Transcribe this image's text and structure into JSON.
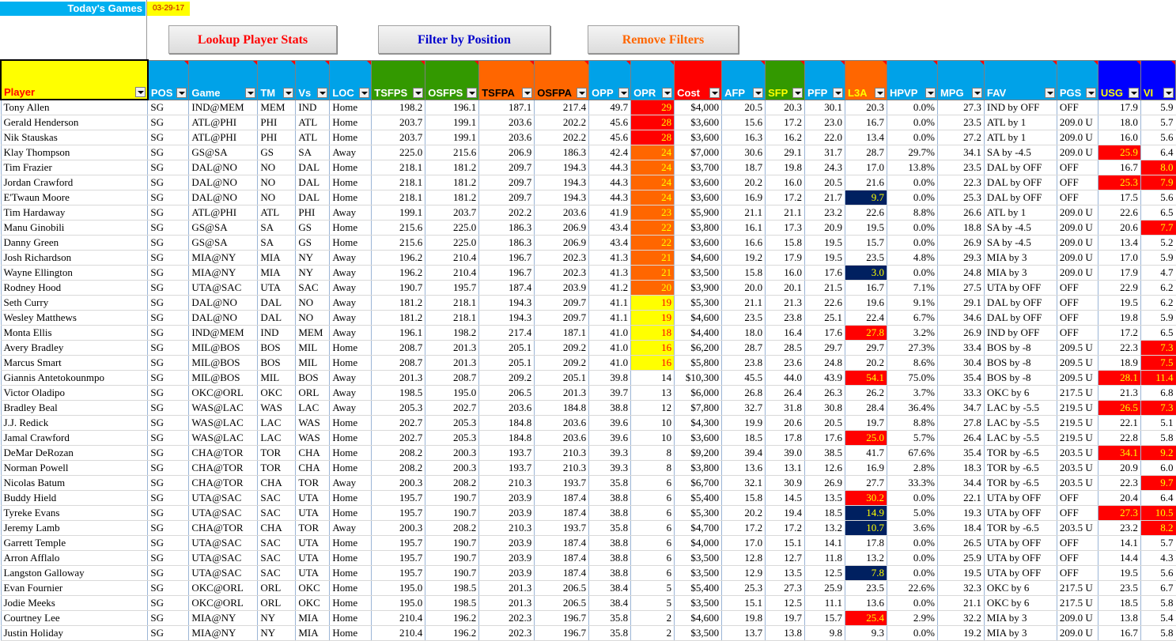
{
  "header": {
    "title": "Today's Games",
    "date": "03-29-17",
    "buttons": {
      "lookup": "Lookup Player Stats",
      "filter": "Filter by Position",
      "remove": "Remove Filters"
    }
  },
  "colors": {
    "yellow": "#ffff00",
    "orange": "#ff6600",
    "red": "#ff0000",
    "navy": "#002060",
    "green": "#339900",
    "blue": "#00a2e8",
    "darkblue": "#0000ff",
    "accent_text_red": "#ff0000",
    "accent_text_blue": "#0000cc"
  },
  "columns": [
    {
      "key": "player",
      "label": "Player",
      "width": 186,
      "bg": "#ffff00",
      "fg": "#ff0000"
    },
    {
      "key": "pos",
      "label": "POS",
      "width": 52,
      "bg": "#00a2e8",
      "fg": "#ffffff"
    },
    {
      "key": "game",
      "label": "Game",
      "width": 87,
      "bg": "#00a2e8",
      "fg": "#ffffff"
    },
    {
      "key": "tm",
      "label": "TM",
      "width": 48,
      "bg": "#00a2e8",
      "fg": "#ffffff"
    },
    {
      "key": "vs",
      "label": "Vs",
      "width": 43,
      "bg": "#00a2e8",
      "fg": "#ffffff"
    },
    {
      "key": "loc",
      "label": "LOC",
      "width": 53,
      "bg": "#00a2e8",
      "fg": "#ffffff"
    },
    {
      "key": "tsfps",
      "label": "TSFPS",
      "width": 68,
      "bg": "#339900",
      "fg": "#ffffff"
    },
    {
      "key": "osfps",
      "label": "OSFPS",
      "width": 68,
      "bg": "#339900",
      "fg": "#ffffff"
    },
    {
      "key": "tsfpa",
      "label": "TSFPA",
      "width": 70,
      "bg": "#ff6600",
      "fg": "#000000"
    },
    {
      "key": "osfpa",
      "label": "OSFPA",
      "width": 69,
      "bg": "#ff6600",
      "fg": "#000000"
    },
    {
      "key": "opp",
      "label": "OPP",
      "width": 53,
      "bg": "#00a2e8",
      "fg": "#ffffff"
    },
    {
      "key": "opr",
      "label": "OPR",
      "width": 55,
      "bg": "#00a2e8",
      "fg": "#ffffff"
    },
    {
      "key": "cost",
      "label": "Cost",
      "width": 60,
      "bg": "#ff0000",
      "fg": "#ffffff"
    },
    {
      "key": "afp",
      "label": "AFP",
      "width": 55,
      "bg": "#00a2e8",
      "fg": "#ffffff"
    },
    {
      "key": "sfp",
      "label": "SFP",
      "width": 50,
      "bg": "#339900",
      "fg": "#ffff00"
    },
    {
      "key": "pfp",
      "label": "PFP",
      "width": 51,
      "bg": "#00a2e8",
      "fg": "#ffffff"
    },
    {
      "key": "l3a",
      "label": "L3A",
      "width": 53,
      "bg": "#ff6600",
      "fg": "#ffff00"
    },
    {
      "key": "hpvp",
      "label": "HPVP",
      "width": 64,
      "bg": "#00a2e8",
      "fg": "#ffffff"
    },
    {
      "key": "mpg",
      "label": "MPG",
      "width": 59,
      "bg": "#00a2e8",
      "fg": "#ffffff"
    },
    {
      "key": "fav",
      "label": "FAV",
      "width": 92,
      "bg": "#00a2e8",
      "fg": "#ffffff"
    },
    {
      "key": "pgs",
      "label": "PGS",
      "width": 52,
      "bg": "#00a2e8",
      "fg": "#ffffff"
    },
    {
      "key": "usg",
      "label": "USG",
      "width": 54,
      "bg": "#0000ff",
      "fg": "#ffff00"
    },
    {
      "key": "vi",
      "label": "VI",
      "width": 44,
      "bg": "#0000ff",
      "fg": "#ffff00"
    }
  ],
  "rows": [
    [
      "Tony Allen",
      "SG",
      "IND@MEM",
      "MEM",
      "IND",
      "Home",
      "198.2",
      "196.1",
      "187.1",
      "217.4",
      "49.7",
      "29",
      "$4,000",
      "20.5",
      "20.3",
      "30.1",
      "20.3",
      "0.0%",
      "27.3",
      "IND by OFF",
      "OFF",
      "17.9",
      "5.9"
    ],
    [
      "Gerald Henderson",
      "SG",
      "ATL@PHI",
      "PHI",
      "ATL",
      "Home",
      "203.7",
      "199.1",
      "203.6",
      "202.2",
      "45.6",
      "28",
      "$3,600",
      "15.6",
      "17.2",
      "23.0",
      "16.7",
      "0.0%",
      "23.5",
      "ATL by 1",
      "209.0 U",
      "18.0",
      "5.7"
    ],
    [
      "Nik Stauskas",
      "SG",
      "ATL@PHI",
      "PHI",
      "ATL",
      "Home",
      "203.7",
      "199.1",
      "203.6",
      "202.2",
      "45.6",
      "28",
      "$3,600",
      "16.3",
      "16.2",
      "22.0",
      "13.4",
      "0.0%",
      "27.2",
      "ATL by 1",
      "209.0 U",
      "16.0",
      "5.6"
    ],
    [
      "Klay Thompson",
      "SG",
      "GS@SA",
      "GS",
      "SA",
      "Away",
      "225.0",
      "215.6",
      "206.9",
      "186.3",
      "42.4",
      "24",
      "$7,000",
      "30.6",
      "29.1",
      "31.7",
      "28.7",
      "29.7%",
      "34.1",
      "SA by -4.5",
      "209.0 U",
      "25.9",
      "6.4"
    ],
    [
      "Tim Frazier",
      "SG",
      "DAL@NO",
      "NO",
      "DAL",
      "Home",
      "218.1",
      "181.2",
      "209.7",
      "194.3",
      "44.3",
      "24",
      "$3,700",
      "18.7",
      "19.8",
      "24.3",
      "17.0",
      "13.8%",
      "23.5",
      "DAL by OFF",
      "OFF",
      "16.7",
      "8.0"
    ],
    [
      "Jordan Crawford",
      "SG",
      "DAL@NO",
      "NO",
      "DAL",
      "Home",
      "218.1",
      "181.2",
      "209.7",
      "194.3",
      "44.3",
      "24",
      "$3,600",
      "20.2",
      "16.0",
      "20.5",
      "21.6",
      "0.0%",
      "22.3",
      "DAL by OFF",
      "OFF",
      "25.3",
      "7.9"
    ],
    [
      "E'Twaun Moore",
      "SG",
      "DAL@NO",
      "NO",
      "DAL",
      "Home",
      "218.1",
      "181.2",
      "209.7",
      "194.3",
      "44.3",
      "24",
      "$3,600",
      "16.9",
      "17.2",
      "21.7",
      "9.7",
      "0.0%",
      "25.3",
      "DAL by OFF",
      "OFF",
      "17.5",
      "5.6"
    ],
    [
      "Tim Hardaway",
      "SG",
      "ATL@PHI",
      "ATL",
      "PHI",
      "Away",
      "199.1",
      "203.7",
      "202.2",
      "203.6",
      "41.9",
      "23",
      "$5,900",
      "21.1",
      "21.1",
      "23.2",
      "22.6",
      "8.8%",
      "26.6",
      "ATL by 1",
      "209.0 U",
      "22.6",
      "6.5"
    ],
    [
      "Manu Ginobili",
      "SG",
      "GS@SA",
      "SA",
      "GS",
      "Home",
      "215.6",
      "225.0",
      "186.3",
      "206.9",
      "43.4",
      "22",
      "$3,800",
      "16.1",
      "17.3",
      "20.9",
      "19.5",
      "0.0%",
      "18.8",
      "SA by -4.5",
      "209.0 U",
      "20.6",
      "7.7"
    ],
    [
      "Danny Green",
      "SG",
      "GS@SA",
      "SA",
      "GS",
      "Home",
      "215.6",
      "225.0",
      "186.3",
      "206.9",
      "43.4",
      "22",
      "$3,600",
      "16.6",
      "15.8",
      "19.5",
      "15.7",
      "0.0%",
      "26.9",
      "SA by -4.5",
      "209.0 U",
      "13.4",
      "5.2"
    ],
    [
      "Josh Richardson",
      "SG",
      "MIA@NY",
      "MIA",
      "NY",
      "Away",
      "196.2",
      "210.4",
      "196.7",
      "202.3",
      "41.3",
      "21",
      "$4,600",
      "19.2",
      "17.9",
      "19.5",
      "23.5",
      "4.8%",
      "29.3",
      "MIA by 3",
      "209.0 U",
      "17.0",
      "5.9"
    ],
    [
      "Wayne Ellington",
      "SG",
      "MIA@NY",
      "MIA",
      "NY",
      "Away",
      "196.2",
      "210.4",
      "196.7",
      "202.3",
      "41.3",
      "21",
      "$3,500",
      "15.8",
      "16.0",
      "17.6",
      "3.0",
      "0.0%",
      "24.8",
      "MIA by 3",
      "209.0 U",
      "17.9",
      "4.7"
    ],
    [
      "Rodney Hood",
      "SG",
      "UTA@SAC",
      "UTA",
      "SAC",
      "Away",
      "190.7",
      "195.7",
      "187.4",
      "203.9",
      "41.2",
      "20",
      "$3,900",
      "20.0",
      "20.1",
      "21.5",
      "16.7",
      "7.1%",
      "27.5",
      "UTA by OFF",
      "OFF",
      "22.9",
      "6.2"
    ],
    [
      "Seth Curry",
      "SG",
      "DAL@NO",
      "DAL",
      "NO",
      "Away",
      "181.2",
      "218.1",
      "194.3",
      "209.7",
      "41.1",
      "19",
      "$5,300",
      "21.1",
      "21.3",
      "22.6",
      "19.6",
      "9.1%",
      "29.1",
      "DAL by OFF",
      "OFF",
      "19.5",
      "6.2"
    ],
    [
      "Wesley Matthews",
      "SG",
      "DAL@NO",
      "DAL",
      "NO",
      "Away",
      "181.2",
      "218.1",
      "194.3",
      "209.7",
      "41.1",
      "19",
      "$4,600",
      "23.5",
      "23.8",
      "25.1",
      "22.4",
      "6.7%",
      "34.6",
      "DAL by OFF",
      "OFF",
      "19.8",
      "5.9"
    ],
    [
      "Monta Ellis",
      "SG",
      "IND@MEM",
      "IND",
      "MEM",
      "Away",
      "196.1",
      "198.2",
      "217.4",
      "187.1",
      "41.0",
      "18",
      "$4,400",
      "18.0",
      "16.4",
      "17.6",
      "27.8",
      "3.2%",
      "26.9",
      "IND by OFF",
      "OFF",
      "17.2",
      "6.5"
    ],
    [
      "Avery Bradley",
      "SG",
      "MIL@BOS",
      "BOS",
      "MIL",
      "Home",
      "208.7",
      "201.3",
      "205.1",
      "209.2",
      "41.0",
      "16",
      "$6,200",
      "28.7",
      "28.5",
      "29.7",
      "29.7",
      "27.3%",
      "33.4",
      "BOS by -8",
      "209.5 U",
      "22.3",
      "7.3"
    ],
    [
      "Marcus Smart",
      "SG",
      "MIL@BOS",
      "BOS",
      "MIL",
      "Home",
      "208.7",
      "201.3",
      "205.1",
      "209.2",
      "41.0",
      "16",
      "$5,800",
      "23.8",
      "23.6",
      "24.8",
      "20.2",
      "8.6%",
      "30.4",
      "BOS by -8",
      "209.5 U",
      "18.9",
      "7.5"
    ],
    [
      "Giannis Antetokounmpo",
      "SG",
      "MIL@BOS",
      "MIL",
      "BOS",
      "Away",
      "201.3",
      "208.7",
      "209.2",
      "205.1",
      "39.8",
      "14",
      "$10,300",
      "45.5",
      "44.0",
      "43.9",
      "54.1",
      "75.0%",
      "35.4",
      "BOS by -8",
      "209.5 U",
      "28.1",
      "11.4"
    ],
    [
      "Victor Oladipo",
      "SG",
      "OKC@ORL",
      "OKC",
      "ORL",
      "Away",
      "198.5",
      "195.0",
      "206.5",
      "201.3",
      "39.7",
      "13",
      "$6,000",
      "26.8",
      "26.4",
      "26.3",
      "26.2",
      "3.7%",
      "33.3",
      "OKC by 6",
      "217.5 U",
      "21.3",
      "6.8"
    ],
    [
      "Bradley Beal",
      "SG",
      "WAS@LAC",
      "WAS",
      "LAC",
      "Away",
      "205.3",
      "202.7",
      "203.6",
      "184.8",
      "38.8",
      "12",
      "$7,800",
      "32.7",
      "31.8",
      "30.8",
      "28.4",
      "36.4%",
      "34.7",
      "LAC by -5.5",
      "219.5 U",
      "26.5",
      "7.3"
    ],
    [
      "J.J. Redick",
      "SG",
      "WAS@LAC",
      "LAC",
      "WAS",
      "Home",
      "202.7",
      "205.3",
      "184.8",
      "203.6",
      "39.6",
      "10",
      "$4,300",
      "19.9",
      "20.6",
      "20.5",
      "19.7",
      "8.8%",
      "27.8",
      "LAC by -5.5",
      "219.5 U",
      "22.1",
      "5.1"
    ],
    [
      "Jamal Crawford",
      "SG",
      "WAS@LAC",
      "LAC",
      "WAS",
      "Home",
      "202.7",
      "205.3",
      "184.8",
      "203.6",
      "39.6",
      "10",
      "$3,600",
      "18.5",
      "17.8",
      "17.6",
      "25.0",
      "5.7%",
      "26.4",
      "LAC by -5.5",
      "219.5 U",
      "22.8",
      "5.8"
    ],
    [
      "DeMar DeRozan",
      "SG",
      "CHA@TOR",
      "TOR",
      "CHA",
      "Home",
      "208.2",
      "200.3",
      "193.7",
      "210.3",
      "39.3",
      "8",
      "$9,200",
      "39.4",
      "39.0",
      "38.5",
      "41.7",
      "67.6%",
      "35.4",
      "TOR by -6.5",
      "203.5 U",
      "34.1",
      "9.2"
    ],
    [
      "Norman Powell",
      "SG",
      "CHA@TOR",
      "TOR",
      "CHA",
      "Home",
      "208.2",
      "200.3",
      "193.7",
      "210.3",
      "39.3",
      "8",
      "$3,800",
      "13.6",
      "13.1",
      "12.6",
      "16.9",
      "2.8%",
      "18.3",
      "TOR by -6.5",
      "203.5 U",
      "20.9",
      "6.0"
    ],
    [
      "Nicolas Batum",
      "SG",
      "CHA@TOR",
      "CHA",
      "TOR",
      "Away",
      "200.3",
      "208.2",
      "210.3",
      "193.7",
      "35.8",
      "6",
      "$6,700",
      "32.1",
      "30.9",
      "26.9",
      "27.7",
      "33.3%",
      "34.4",
      "TOR by -6.5",
      "203.5 U",
      "22.3",
      "9.7"
    ],
    [
      "Buddy Hield",
      "SG",
      "UTA@SAC",
      "SAC",
      "UTA",
      "Home",
      "195.7",
      "190.7",
      "203.9",
      "187.4",
      "38.8",
      "6",
      "$5,400",
      "15.8",
      "14.5",
      "13.5",
      "30.2",
      "0.0%",
      "22.1",
      "UTA by OFF",
      "OFF",
      "20.4",
      "6.4"
    ],
    [
      "Tyreke Evans",
      "SG",
      "UTA@SAC",
      "SAC",
      "UTA",
      "Home",
      "195.7",
      "190.7",
      "203.9",
      "187.4",
      "38.8",
      "6",
      "$5,300",
      "20.2",
      "19.4",
      "18.5",
      "14.9",
      "5.0%",
      "19.3",
      "UTA by OFF",
      "OFF",
      "27.3",
      "10.5"
    ],
    [
      "Jeremy Lamb",
      "SG",
      "CHA@TOR",
      "CHA",
      "TOR",
      "Away",
      "200.3",
      "208.2",
      "210.3",
      "193.7",
      "35.8",
      "6",
      "$4,700",
      "17.2",
      "17.2",
      "13.2",
      "10.7",
      "3.6%",
      "18.4",
      "TOR by -6.5",
      "203.5 U",
      "23.2",
      "8.2"
    ],
    [
      "Garrett Temple",
      "SG",
      "UTA@SAC",
      "SAC",
      "UTA",
      "Home",
      "195.7",
      "190.7",
      "203.9",
      "187.4",
      "38.8",
      "6",
      "$4,000",
      "17.0",
      "15.1",
      "14.1",
      "17.8",
      "0.0%",
      "26.5",
      "UTA by OFF",
      "OFF",
      "14.1",
      "5.7"
    ],
    [
      "Arron Afflalo",
      "SG",
      "UTA@SAC",
      "SAC",
      "UTA",
      "Home",
      "195.7",
      "190.7",
      "203.9",
      "187.4",
      "38.8",
      "6",
      "$3,500",
      "12.8",
      "12.7",
      "11.8",
      "13.2",
      "0.0%",
      "25.9",
      "UTA by OFF",
      "OFF",
      "14.4",
      "4.3"
    ],
    [
      "Langston Galloway",
      "SG",
      "UTA@SAC",
      "SAC",
      "UTA",
      "Home",
      "195.7",
      "190.7",
      "203.9",
      "187.4",
      "38.8",
      "6",
      "$3,500",
      "12.9",
      "13.5",
      "12.5",
      "7.8",
      "0.0%",
      "19.5",
      "UTA by OFF",
      "OFF",
      "19.5",
      "5.6"
    ],
    [
      "Evan Fournier",
      "SG",
      "OKC@ORL",
      "ORL",
      "OKC",
      "Home",
      "195.0",
      "198.5",
      "201.3",
      "206.5",
      "38.4",
      "5",
      "$5,400",
      "25.3",
      "27.3",
      "25.9",
      "23.5",
      "22.6%",
      "32.3",
      "OKC by 6",
      "217.5 U",
      "23.5",
      "6.7"
    ],
    [
      "Jodie Meeks",
      "SG",
      "OKC@ORL",
      "ORL",
      "OKC",
      "Home",
      "195.0",
      "198.5",
      "201.3",
      "206.5",
      "38.4",
      "5",
      "$3,500",
      "15.1",
      "12.5",
      "11.1",
      "13.6",
      "0.0%",
      "21.1",
      "OKC by 6",
      "217.5 U",
      "18.5",
      "5.8"
    ],
    [
      "Courtney Lee",
      "SG",
      "MIA@NY",
      "NY",
      "MIA",
      "Home",
      "210.4",
      "196.2",
      "202.3",
      "196.7",
      "35.8",
      "2",
      "$4,600",
      "19.8",
      "19.7",
      "15.7",
      "25.4",
      "2.9%",
      "32.2",
      "MIA by 3",
      "209.0 U",
      "13.8",
      "5.4"
    ],
    [
      "Justin Holiday",
      "SG",
      "MIA@NY",
      "NY",
      "MIA",
      "Home",
      "210.4",
      "196.2",
      "202.3",
      "196.7",
      "35.8",
      "2",
      "$3,500",
      "13.7",
      "13.8",
      "9.8",
      "9.3",
      "0.0%",
      "19.2",
      "MIA by 3",
      "209.0 U",
      "16.7",
      "5.8"
    ]
  ],
  "highlights": {
    "opr": [
      "red",
      "red",
      "red",
      "orange",
      "orange",
      "orange",
      "orange",
      "orange",
      "orange",
      "orange",
      "orange",
      "orange",
      "orange",
      "yellow",
      "yellow",
      "yellow",
      "yellow",
      "yellow",
      "",
      "",
      "",
      "",
      "",
      "",
      "",
      "",
      "",
      "",
      "",
      "",
      "",
      "",
      "",
      "",
      "",
      ""
    ],
    "l3a": [
      "",
      "",
      "",
      "",
      "",
      "",
      "navy",
      "",
      "",
      "",
      "",
      "navy",
      "",
      "",
      "",
      "red",
      "",
      "",
      "red",
      "",
      "",
      "",
      "red",
      "",
      "",
      "",
      "red",
      "navy",
      "navy",
      "",
      "",
      "navy",
      "",
      "",
      "red",
      ""
    ],
    "usg": [
      "",
      "",
      "",
      "red",
      "",
      "red",
      "",
      "",
      "",
      "",
      "",
      "",
      "",
      "",
      "",
      "",
      "",
      "",
      "red",
      "",
      "red",
      "",
      "",
      "red",
      "",
      "",
      "",
      "red",
      "",
      "",
      "",
      "",
      "",
      "",
      "",
      ""
    ],
    "vi": [
      "",
      "",
      "",
      "",
      "red",
      "red",
      "",
      "",
      "red",
      "",
      "",
      "",
      "",
      "",
      "",
      "",
      "red",
      "red",
      "red",
      "",
      "red",
      "",
      "",
      "red",
      "",
      "red",
      "",
      "red",
      "red",
      "",
      "",
      "",
      "",
      "",
      "",
      ""
    ]
  }
}
